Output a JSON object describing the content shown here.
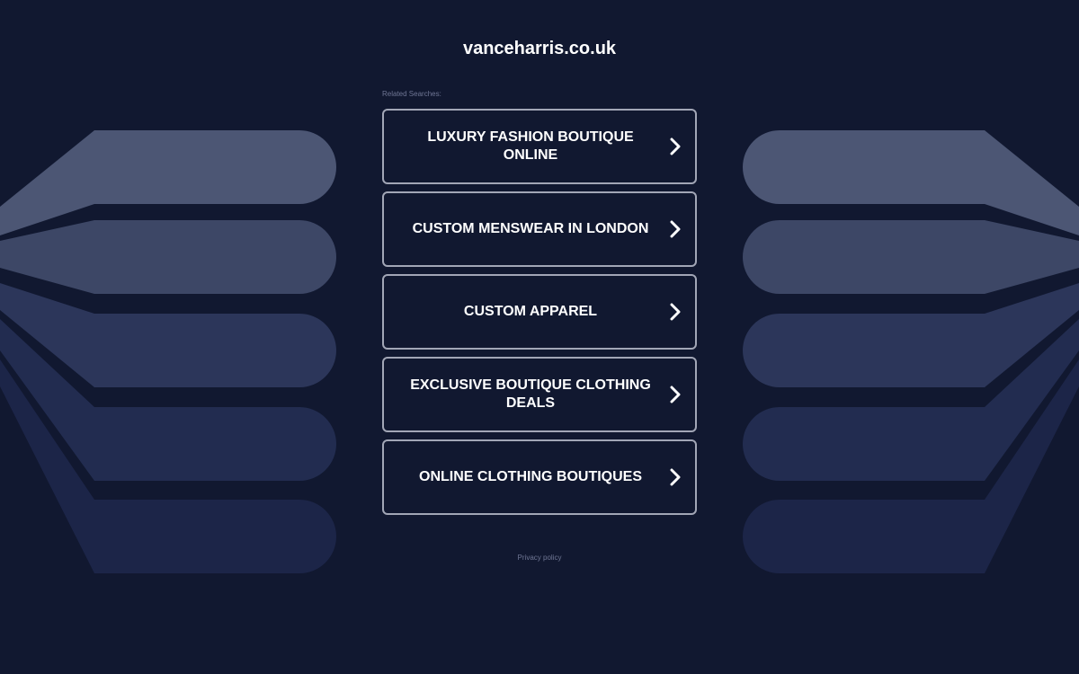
{
  "header": {
    "domain": "vanceharris.co.uk"
  },
  "related": {
    "label": "Related Searches:",
    "items": [
      {
        "label": "LUXURY FASHION BOUTIQUE ONLINE"
      },
      {
        "label": "CUSTOM MENSWEAR IN LONDON"
      },
      {
        "label": "CUSTOM APPAREL"
      },
      {
        "label": "EXCLUSIVE BOUTIQUE CLOTHING DEALS"
      },
      {
        "label": "ONLINE CLOTHING BOUTIQUES"
      }
    ],
    "item_icon": "chevron-right-icon"
  },
  "footer": {
    "privacy_label": "Privacy policy"
  },
  "colors": {
    "background": "#111830",
    "text": "#ffffff",
    "border": "#a2a6b6",
    "muted": "#6f7694",
    "decor_bands": [
      "#4c5674",
      "#3d4766",
      "#2c365a",
      "#222c50",
      "#1c2548"
    ]
  }
}
